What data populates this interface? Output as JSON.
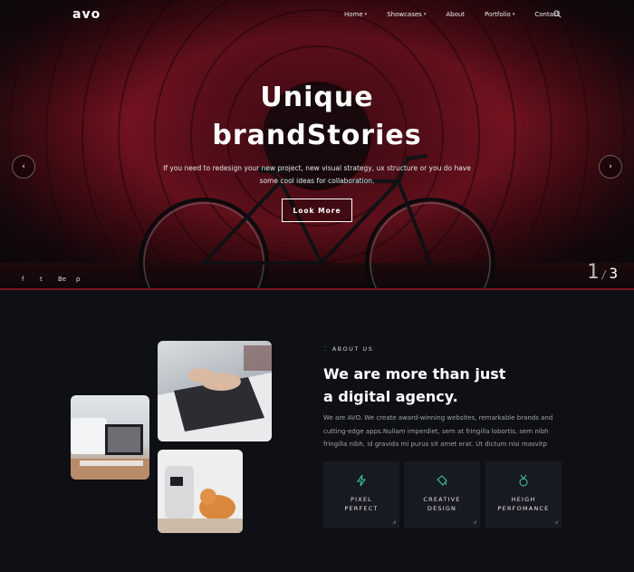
{
  "nav": {
    "logo": "avo",
    "items": [
      {
        "label": "Home",
        "dropdown": true
      },
      {
        "label": "Showcases",
        "dropdown": true
      },
      {
        "label": "About",
        "dropdown": false
      },
      {
        "label": "Portfolio",
        "dropdown": true
      },
      {
        "label": "Contact",
        "dropdown": false
      }
    ],
    "caret": "▾"
  },
  "hero": {
    "title_line1": "Unique",
    "title_line2": "brandStories",
    "subtitle": "If you need to redesign your new project, new visual strategy, ux structure or you do have some cool ideas for collaboration.",
    "button": "Look More",
    "prev": "‹",
    "next": "›",
    "social": [
      "f",
      "t",
      "Be",
      "p"
    ],
    "slide_current": "1",
    "slide_sep": "/",
    "slide_total": "3"
  },
  "about": {
    "eyebrow": "ABOUT US",
    "title_line1": "We are more than just",
    "title_line2": "a digital agency.",
    "text": "We are AVO. We create award-winning websites, remarkable brands and cutting-edge apps.Nullam imperdiet, sem at fringilla lobortis, sem nibh fringilla nibh, id gravida mi purus sit amet erat. Ut dictum nisi masvitp",
    "features": [
      {
        "line1": "PIXEL",
        "line2": "PERFECT",
        "icon": "bolt-icon"
      },
      {
        "line1": "CREATIVE",
        "line2": "DESIGN",
        "icon": "paint-bucket-icon"
      },
      {
        "line1": "HEIGH",
        "line2": "PERFOMANCE",
        "icon": "medal-icon"
      }
    ]
  },
  "colors": {
    "accent": "#3fd0b0",
    "background": "#0e1015",
    "card": "#181a21",
    "hero_red": "#7a1422"
  }
}
